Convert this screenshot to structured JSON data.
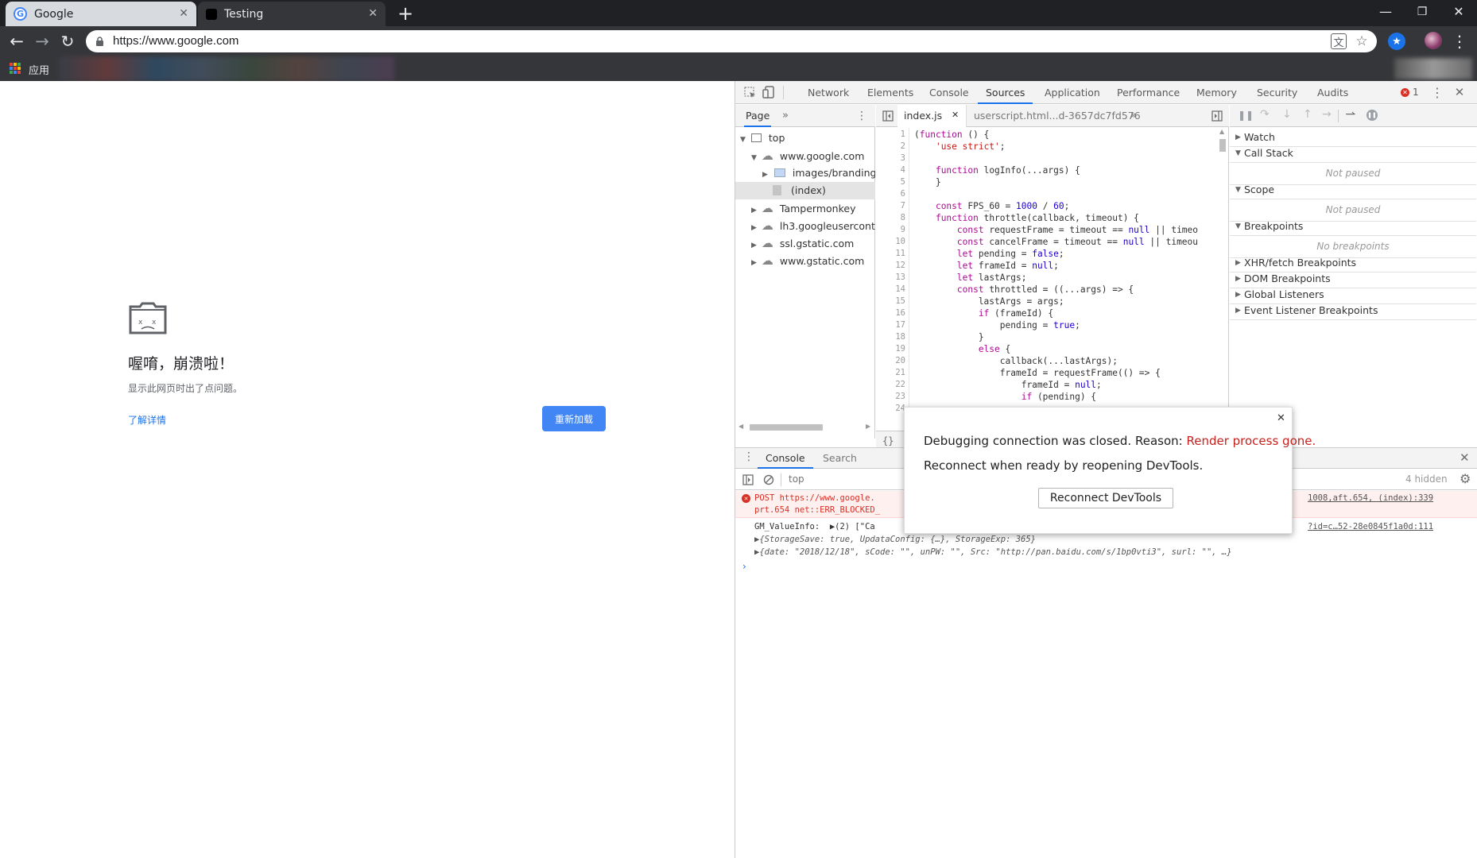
{
  "browser": {
    "tabs": [
      {
        "title": "Google",
        "favicon": "google-g-icon",
        "active": true
      },
      {
        "title": "Testing",
        "favicon": "black-square-icon",
        "active": false
      }
    ],
    "address": "https://www.google.com",
    "bookmarks_apps_label": "应用"
  },
  "crash_page": {
    "title": "喔唷，崩溃啦！",
    "message": "显示此网页时出了点问题。",
    "learn_more": "了解详情",
    "reload_button": "重新加载"
  },
  "devtools": {
    "tabs": [
      "Network",
      "Elements",
      "Console",
      "Sources",
      "Application",
      "Performance",
      "Memory",
      "Security",
      "Audits"
    ],
    "active_tab": "Sources",
    "error_count": "1",
    "navigator": {
      "tab": "Page",
      "tree": [
        {
          "label": "top",
          "type": "frame"
        },
        {
          "label": "www.google.com",
          "type": "cloud"
        },
        {
          "label": "images/branding/",
          "type": "folder"
        },
        {
          "label": "(index)",
          "type": "file"
        },
        {
          "label": "Tampermonkey",
          "type": "cloud"
        },
        {
          "label": "lh3.googleuserconte",
          "type": "cloud"
        },
        {
          "label": "ssl.gstatic.com",
          "type": "cloud"
        },
        {
          "label": "www.gstatic.com",
          "type": "cloud"
        }
      ]
    },
    "editor": {
      "tabs": [
        {
          "label": "index.js",
          "closable": true
        },
        {
          "label": "userscript.html...d-3657dc7fd576",
          "closable": false
        }
      ],
      "line_numbers": [
        "1",
        "2",
        "3",
        "4",
        "5",
        "6",
        "7",
        "8",
        "9",
        "10",
        "11",
        "12",
        "13",
        "14",
        "15",
        "16",
        "17",
        "18",
        "19",
        "20",
        "21",
        "22",
        "23",
        "24"
      ],
      "lines": [
        "(function () {",
        "    'use strict';",
        "",
        "    function logInfo(...args) {",
        "    }",
        "",
        "    const FPS_60 = 1000 / 60;",
        "    function throttle(callback, timeout) {",
        "        const requestFrame = timeout == null || timeo",
        "        const cancelFrame = timeout == null || timeou",
        "        let pending = false;",
        "        let frameId = null;",
        "        let lastArgs;",
        "        const throttled = ((...args) => {",
        "            lastArgs = args;",
        "            if (frameId) {",
        "                pending = true;",
        "            }",
        "            else {",
        "                callback(...lastArgs);",
        "                frameId = requestFrame(() => {",
        "                    frameId = null;",
        "                    if (pending) {",
        ""
      ]
    },
    "debugger_sections": [
      {
        "label": "Watch",
        "expanded": false
      },
      {
        "label": "Call Stack",
        "expanded": true,
        "empty": "Not paused"
      },
      {
        "label": "Scope",
        "expanded": true,
        "empty": "Not paused"
      },
      {
        "label": "Breakpoints",
        "expanded": true,
        "empty": "No breakpoints"
      },
      {
        "label": "XHR/fetch Breakpoints",
        "expanded": false
      },
      {
        "label": "DOM Breakpoints",
        "expanded": false
      },
      {
        "label": "Global Listeners",
        "expanded": false
      },
      {
        "label": "Event Listener Breakpoints",
        "expanded": false
      }
    ],
    "drawer": {
      "tabs": [
        "Console",
        "Search"
      ],
      "context": "top",
      "hidden_count": "4 hidden",
      "messages": [
        {
          "type": "error",
          "text1": "POST https://www.google.",
          "text2": "prt.654 net::ERR_BLOCKED_",
          "source": "1008,aft.654, (index):339"
        },
        {
          "type": "log",
          "text1": "GM_ValueInfo:  ▶(2) [\"Ca",
          "source": "?id=c…52-28e0845f1a0d:111"
        },
        {
          "type": "object",
          "text1": "▶{StorageSave: true, UpdataConfig: {…}, StorageExp: 365}"
        },
        {
          "type": "object",
          "text1": "▶{date: \"2018/12/18\", sCode: \"\", unPW: \"\", Src: \"http://pan.baidu.com/s/1bp0vti3\", surl: \"\", …}"
        }
      ]
    },
    "dialog": {
      "line1_prefix": "Debugging connection was closed. Reason: ",
      "line1_reason": "Render process gone.",
      "line2": "Reconnect when ready by reopening DevTools.",
      "button": "Reconnect DevTools"
    }
  },
  "colors": {
    "titlebar": "#202124",
    "toolbar": "#35363a",
    "accent_blue": "#4285f4",
    "link_blue": "#1a73e8",
    "error_red": "#d93025",
    "reason_red": "#c5221f"
  }
}
